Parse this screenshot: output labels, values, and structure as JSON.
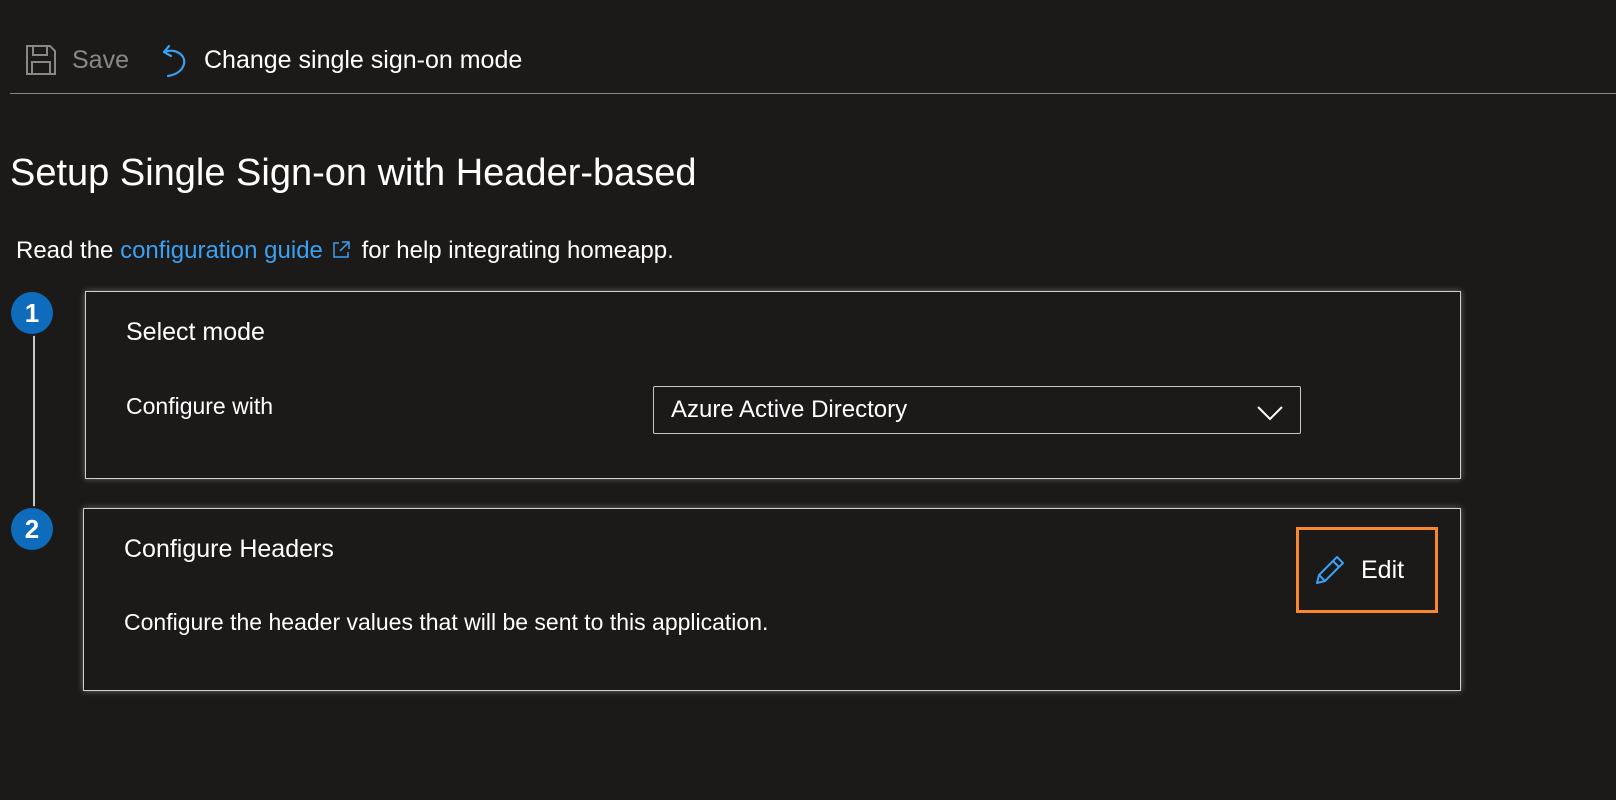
{
  "toolbar": {
    "save_label": "Save",
    "change_mode_label": "Change single sign-on mode",
    "save_icon": "save-icon",
    "undo_icon": "undo-icon"
  },
  "page": {
    "title": "Setup Single Sign-on with Header-based",
    "intro_prefix": "Read the",
    "intro_link": "configuration guide",
    "intro_suffix": "for help integrating homeapp."
  },
  "steps": [
    {
      "number": "1"
    },
    {
      "number": "2"
    }
  ],
  "select_mode": {
    "title": "Select mode",
    "field_label": "Configure with",
    "selected_value": "Azure Active Directory"
  },
  "configure_headers": {
    "title": "Configure Headers",
    "description": "Configure the header values that will be sent to this application.",
    "edit_label": "Edit"
  },
  "colors": {
    "background": "#1b1a19",
    "link": "#3aa0f3",
    "step_badge": "#0f6cbd",
    "highlight": "#f7882f",
    "disabled_text": "#8a8886"
  }
}
